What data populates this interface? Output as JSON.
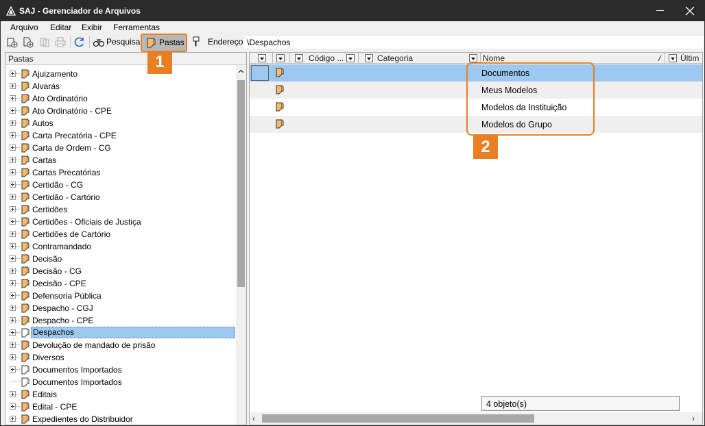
{
  "window": {
    "title": "SAJ - Gerenciador de Arquivos"
  },
  "menu": [
    "Arquivo",
    "Editar",
    "Exibir",
    "Ferramentas"
  ],
  "toolbar": {
    "search_label": "Pesquisar",
    "folders_label": "Pastas",
    "address_label": "Endereço",
    "address_value": "\\Despachos"
  },
  "left_panel": {
    "header": "Pastas",
    "items": [
      "Ajuizamento",
      "Alvarás",
      "Ato Ordinatório",
      "Ato Ordinatório - CPE",
      "Autos",
      "Carta Precatória - CPE",
      "Carta de Ordem - CG",
      "Cartas",
      "Cartas Precatórias",
      "Certidão - CG",
      "Certidão - Cartório",
      "Certidões",
      "Certidões - Oficiais de Justiça",
      "Certidões de Cartório",
      "Contramandado",
      "Decisão",
      "Decisão - CG",
      "Decisão - CPE",
      "Defensoria Pública",
      "Despacho - CGJ",
      "Despacho - CPE",
      "Despachos",
      "Devolução de mandado de prisão",
      "Diversos",
      "Documentos Importados",
      "Documentos Importados",
      "Editais",
      "Edital - CPE",
      "Expedientes do Distribuidor"
    ],
    "selected": "Despachos"
  },
  "grid": {
    "columns": [
      "Código ...",
      "Categoria",
      "Nome",
      "Últim"
    ],
    "rows": [
      "Documentos",
      "Meus Modelos",
      "Modelos da Instituição",
      "Modelos do Grupo"
    ],
    "status": "4 objeto(s)"
  },
  "annotations": {
    "badge1": "1",
    "badge2": "2",
    "accent_color": "#e87f22"
  },
  "icons": [
    "app-icon",
    "close-icon",
    "folder-icon",
    "binoculars-icon",
    "refresh-icon",
    "print-icon"
  ]
}
